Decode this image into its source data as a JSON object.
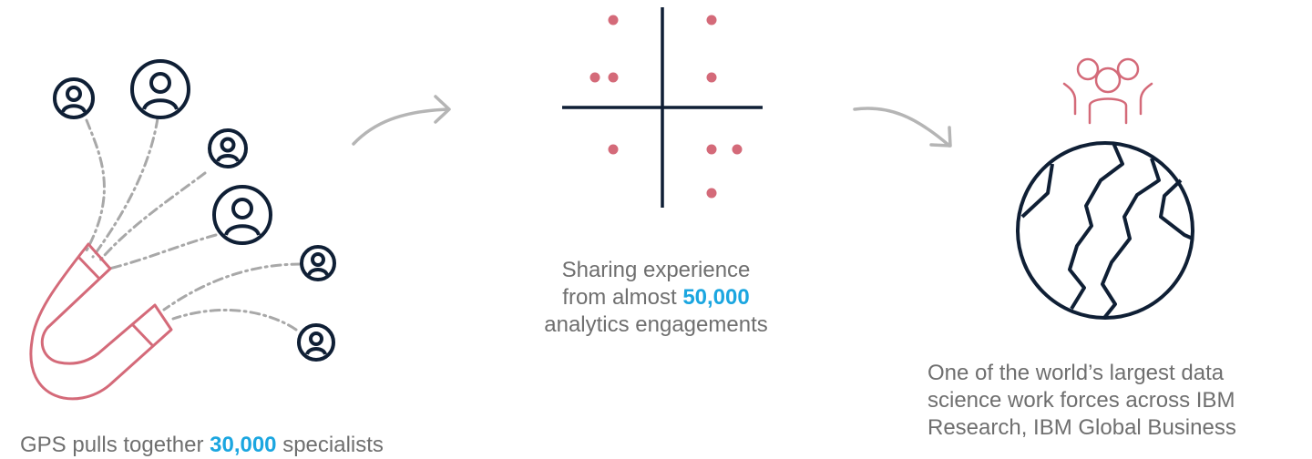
{
  "colors": {
    "navy": "#0f1f35",
    "pink": "#d46a79",
    "gray_arrow": "#b5b5b5",
    "dash": "#a8a8a8",
    "highlight": "#1ba6e0",
    "text": "#6f6f6f"
  },
  "icons": {
    "left": [
      "person-circle-icon",
      "magnet-icon",
      "dash-dot-line"
    ],
    "middle": [
      "quadrant-cross-icon",
      "dot-icon"
    ],
    "right": [
      "people-group-icon",
      "globe-icon"
    ],
    "flow": [
      "curved-arrow-icon"
    ]
  },
  "captions": {
    "specialists": {
      "before": "GPS pulls together ",
      "number": "30,000",
      "after": " specialists"
    },
    "engagements": {
      "line1": "Sharing experience",
      "line2_before": "from almost ",
      "number": "50,000",
      "line3": "analytics engagements"
    },
    "workforce": {
      "line1": "One of the world’s largest data",
      "line2": "science work forces across IBM",
      "line3": "Research, IBM Global Business"
    }
  }
}
